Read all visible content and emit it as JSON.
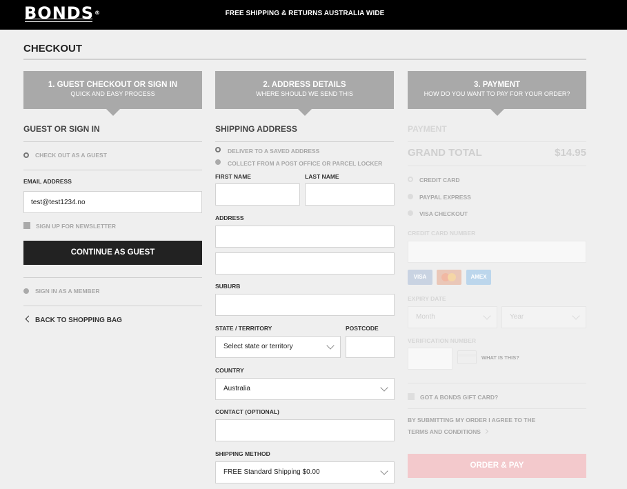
{
  "header": {
    "logo": "BONDS",
    "logo_mark": "®",
    "promo": "FREE SHIPPING & RETURNS AUSTRALIA WIDE"
  },
  "page": {
    "title": "CHECKOUT"
  },
  "steps": [
    {
      "title": "1. GUEST CHECKOUT OR SIGN IN",
      "subtitle": "QUICK AND EASY PROCESS"
    },
    {
      "title": "2. ADDRESS DETAILS",
      "subtitle": "WHERE SHOULD WE SEND THIS"
    },
    {
      "title": "3. PAYMENT",
      "subtitle": "HOW DO YOU WANT TO PAY FOR YOUR ORDER?"
    }
  ],
  "guest": {
    "heading": "GUEST OR SIGN IN",
    "guest_option": "CHECK OUT AS A GUEST",
    "email_label": "EMAIL ADDRESS",
    "email_value": "test@test1234.no",
    "newsletter": "SIGN UP FOR NEWSLETTER",
    "continue_button": "CONTINUE AS GUEST",
    "member_option": "SIGN IN AS A MEMBER",
    "back_link": "BACK TO SHOPPING BAG"
  },
  "shipping": {
    "heading": "SHIPPING ADDRESS",
    "saved_option": "DELIVER TO A SAVED ADDRESS",
    "collect_option": "COLLECT FROM A POST OFFICE OR PARCEL LOCKER",
    "first_name_label": "FIRST NAME",
    "last_name_label": "LAST NAME",
    "address_label": "ADDRESS",
    "suburb_label": "SUBURB",
    "state_label": "STATE / TERRITORY",
    "state_value": "Select state or territory",
    "postcode_label": "POSTCODE",
    "country_label": "COUNTRY",
    "country_value": "Australia",
    "contact_label": "CONTACT (OPTIONAL)",
    "method_label": "SHIPPING METHOD",
    "method_value": "FREE Standard Shipping $0.00"
  },
  "payment": {
    "heading": "PAYMENT",
    "grand_total_label": "GRAND TOTAL",
    "grand_total_value": "$14.95",
    "options": [
      "CREDIT CARD",
      "PAYPAL EXPRESS",
      "VISA CHECKOUT"
    ],
    "card_number_label": "CREDIT CARD NUMBER",
    "card_logos": [
      "VISA",
      "AMEX"
    ],
    "expiry_label": "EXPIRY DATE",
    "month_value": "Month",
    "year_value": "Year",
    "verification_label": "VERIFICATION NUMBER",
    "what_is_this": "WHAT IS THIS?",
    "gift_card": "GOT A BONDS GIFT CARD?",
    "terms_line1": "BY SUBMITTING MY ORDER I AGREE TO THE",
    "terms_line2": "TERMS AND CONDITIONS",
    "order_button": "ORDER & PAY"
  }
}
